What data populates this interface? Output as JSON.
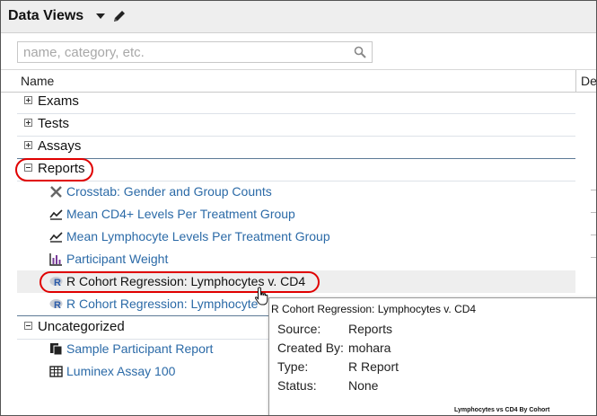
{
  "header": {
    "title": "Data Views"
  },
  "search": {
    "placeholder": "name, category, etc."
  },
  "columns": {
    "name": "Name",
    "truncated_next": "De"
  },
  "groups": {
    "exams": "Exams",
    "tests": "Tests",
    "assays": "Assays",
    "reports": "Reports",
    "uncategorized": "Uncategorized"
  },
  "reports": [
    {
      "label": "Crosstab: Gender and Group Counts",
      "icon": "crosstab-icon"
    },
    {
      "label": "Mean CD4+ Levels Per Treatment Group",
      "icon": "line-chart-icon"
    },
    {
      "label": "Mean Lymphocyte Levels Per Treatment Group",
      "icon": "line-chart-icon"
    },
    {
      "label": "Participant Weight",
      "icon": "bar-chart-icon"
    },
    {
      "label": "R Cohort Regression: Lymphocytes v. CD4",
      "icon": "r-report-icon"
    },
    {
      "label": "R Cohort Regression: Lymphocyte",
      "icon": "r-report-icon"
    }
  ],
  "uncategorized": [
    {
      "label": "Sample Participant Report",
      "icon": "participant-report-icon"
    },
    {
      "label": "Luminex Assay 100",
      "icon": "grid-icon"
    }
  ],
  "tooltip": {
    "title": "R Cohort Regression: Lymphocytes v. CD4",
    "source_label": "Source:",
    "source": "Reports",
    "created_by_label": "Created By:",
    "created_by": "mohara",
    "type_label": "Type:",
    "type": "R Report",
    "status_label": "Status:",
    "status": "None",
    "thumbnail_caption": "Lymphocytes vs CD4 By Cohort"
  },
  "colors": {
    "link": "#2b6aa7",
    "highlight": "#e00000",
    "header_bg": "#eeeeee"
  }
}
